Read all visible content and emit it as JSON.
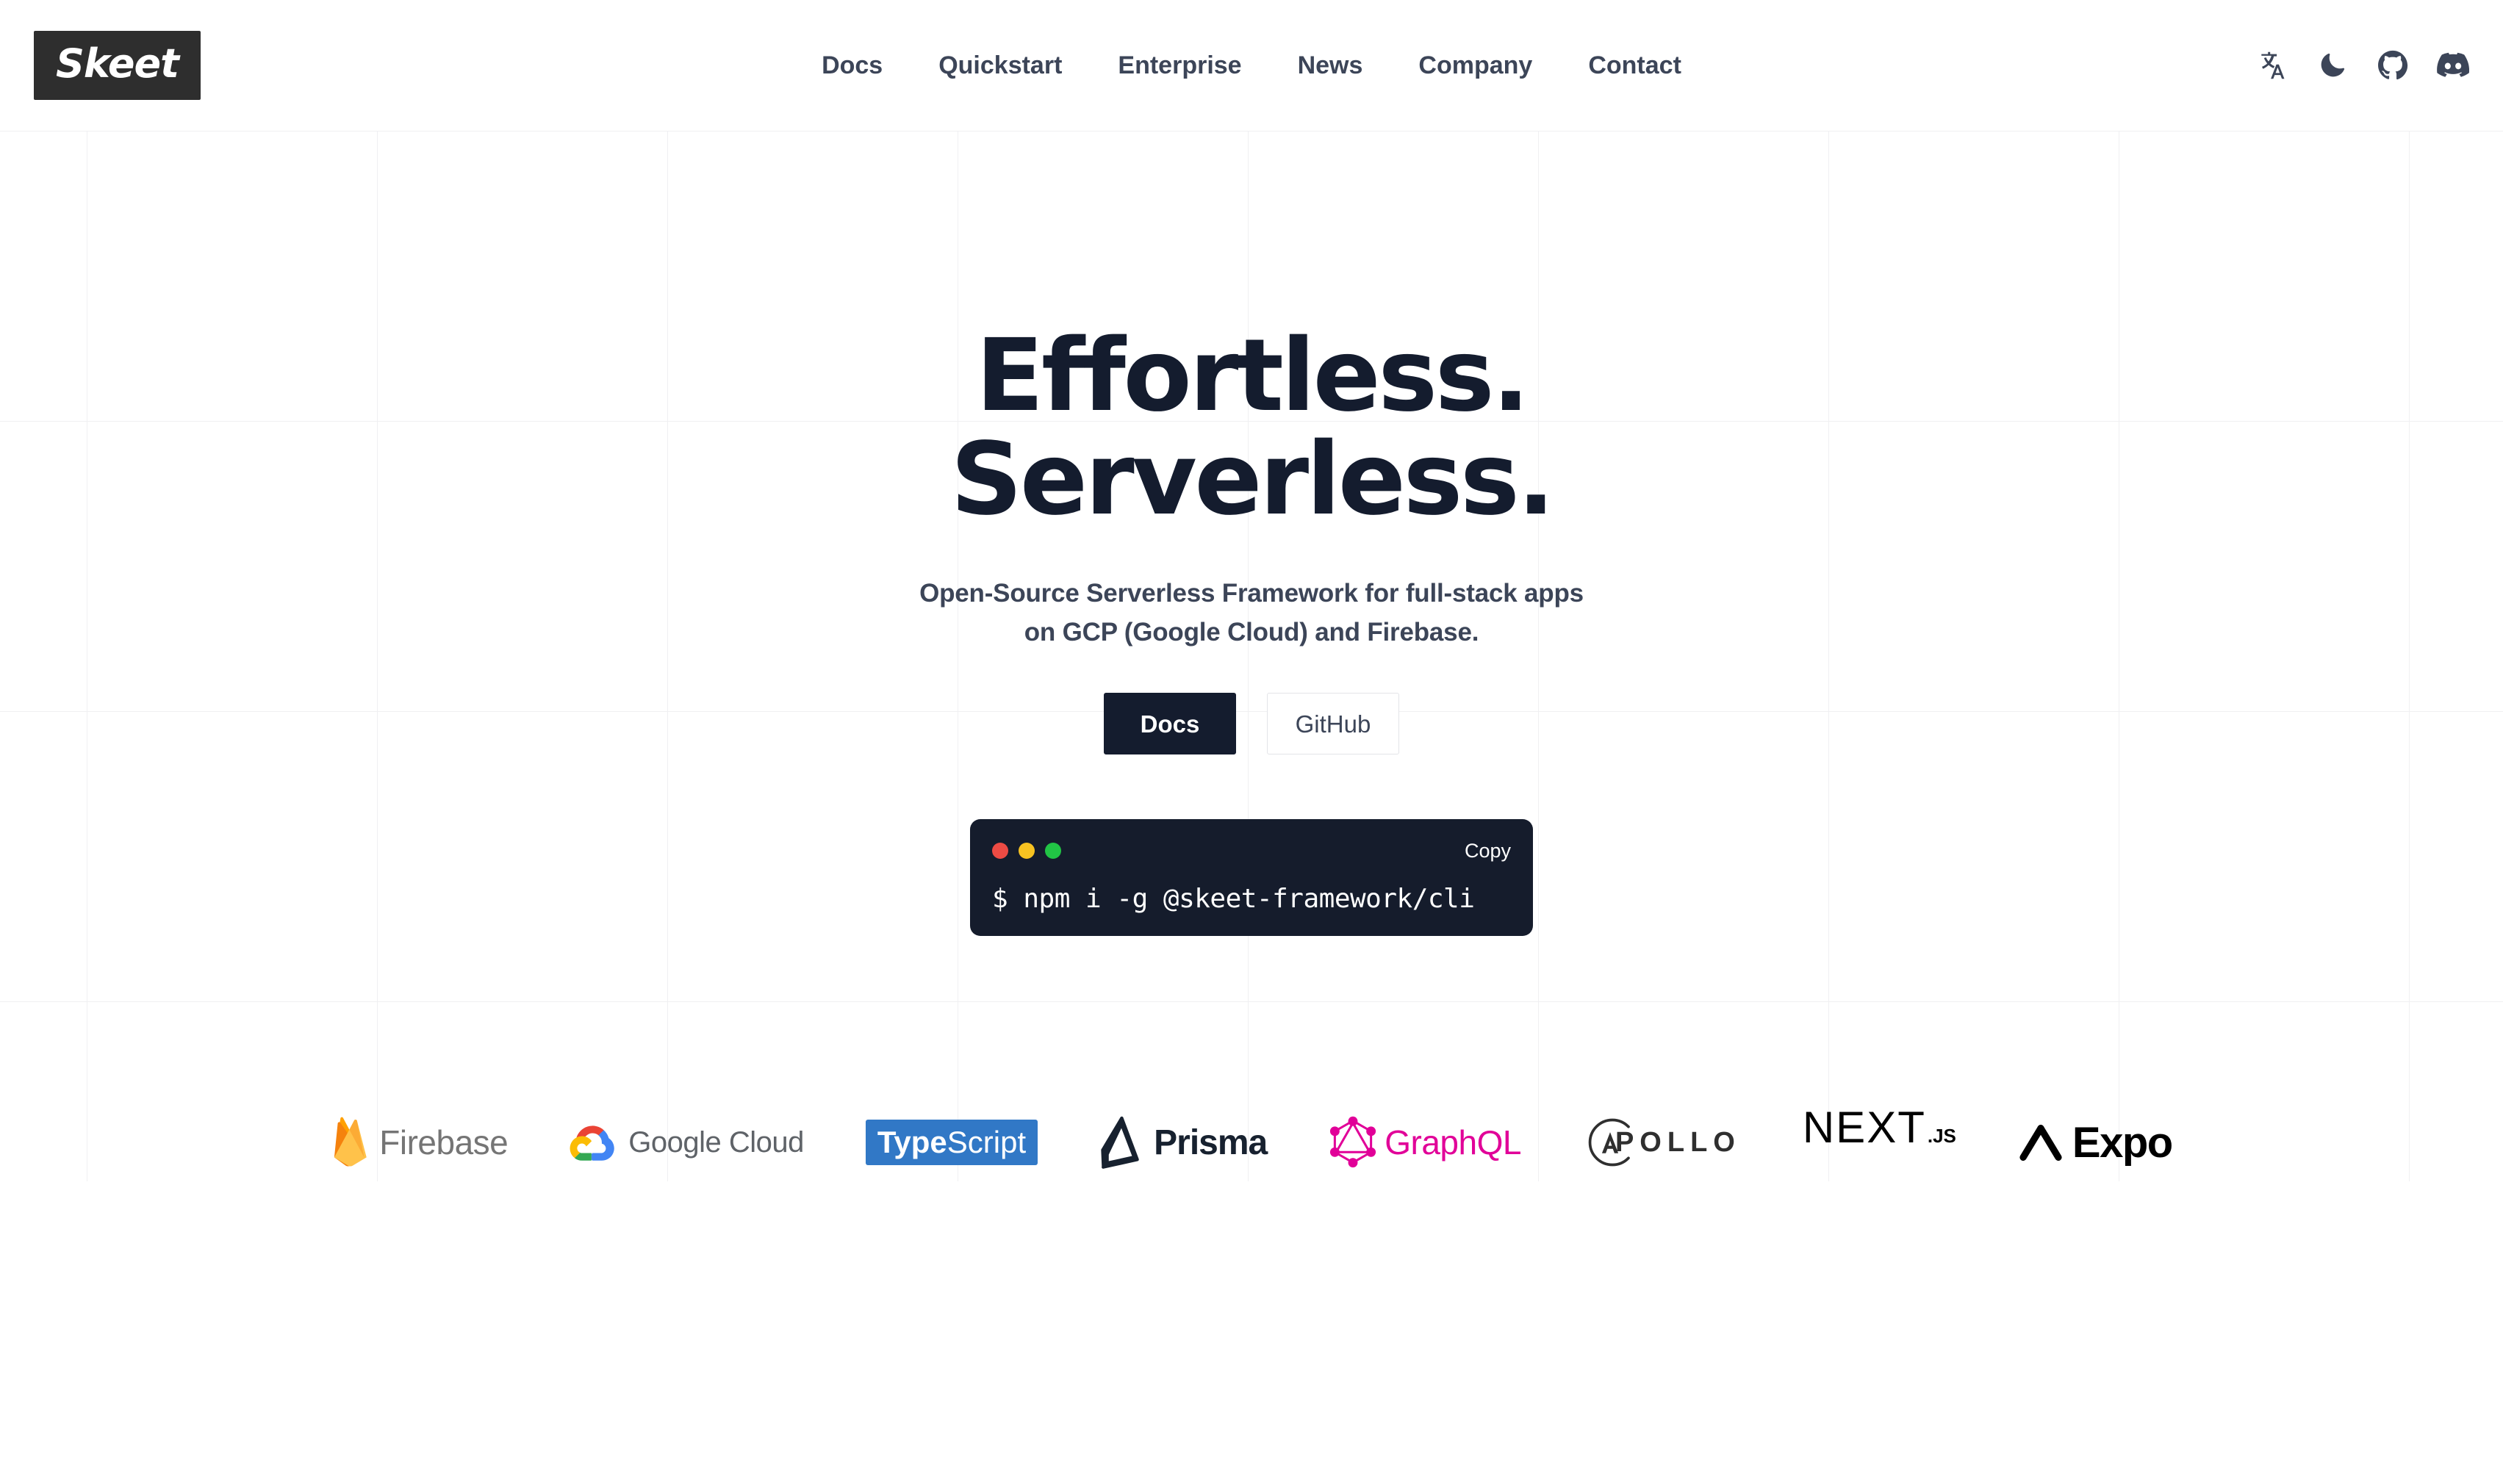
{
  "brand": {
    "logo_text": "Skeet"
  },
  "header": {
    "nav": [
      {
        "label": "Docs"
      },
      {
        "label": "Quickstart"
      },
      {
        "label": "Enterprise"
      },
      {
        "label": "News"
      },
      {
        "label": "Company"
      },
      {
        "label": "Contact"
      }
    ],
    "icons": [
      {
        "name": "translate-icon",
        "label": "Language"
      },
      {
        "name": "moon-icon",
        "label": "Dark mode"
      },
      {
        "name": "github-icon",
        "label": "GitHub"
      },
      {
        "name": "discord-icon",
        "label": "Discord"
      }
    ]
  },
  "hero": {
    "title_line1": "Effortless.",
    "title_line2": "Serverless.",
    "subtitle_line1": "Open-Source Serverless Framework for full-stack apps",
    "subtitle_line2": "on GCP (Google Cloud) and Firebase.",
    "primary_button": "Docs",
    "secondary_button": "GitHub"
  },
  "terminal": {
    "copy_label": "Copy",
    "command": "$ npm i -g @skeet-framework/cli",
    "dots": [
      "#ed4b44",
      "#f7c221",
      "#21c445"
    ]
  },
  "tech_logos": [
    {
      "name": "firebase",
      "label": "Firebase"
    },
    {
      "name": "google-cloud",
      "label": "Google Cloud"
    },
    {
      "name": "typescript",
      "label_bold": "Type",
      "label_light": "Script"
    },
    {
      "name": "prisma",
      "label": "Prisma"
    },
    {
      "name": "graphql",
      "label": "GraphQL"
    },
    {
      "name": "apollo",
      "label": "POLLO",
      "mark_letter": "A"
    },
    {
      "name": "nextjs",
      "label": "NEXT",
      "suffix": ".JS"
    },
    {
      "name": "expo",
      "label": "Expo"
    }
  ],
  "colors": {
    "ink": "#141c2e",
    "body_text": "#3c4558",
    "terminal_bg": "#151c2c",
    "grid_line": "#f0f0f2",
    "typescript_blue": "#3178c6",
    "graphql_pink": "#e10098",
    "firebase_amber": "#ffa000",
    "prisma_navy": "#17212f"
  }
}
